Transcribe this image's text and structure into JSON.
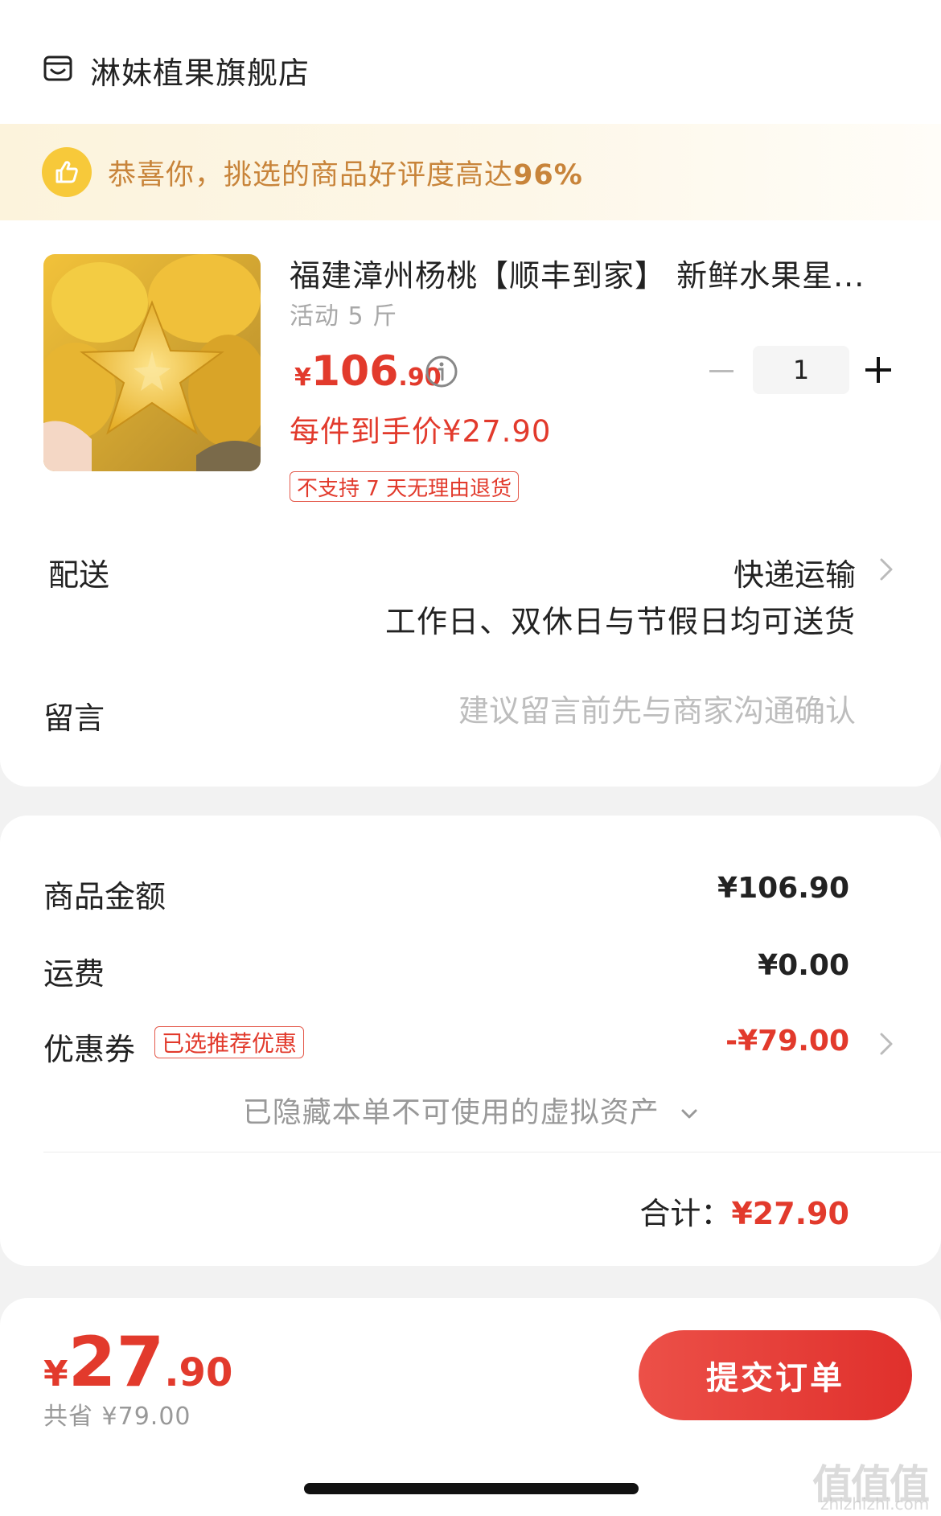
{
  "shop": {
    "name": "淋妹植果旗舰店",
    "icon": "store-icon"
  },
  "rating_banner": {
    "text": "恭喜你，挑选的商品好评度高达",
    "percent": "96%",
    "icon": "thumbs-up-icon"
  },
  "product": {
    "title": "福建漳州杨桃【顺丰到家】 新鲜水果星...",
    "spec": "活动 5 斤",
    "price_symbol": "¥",
    "price_integer": "106",
    "price_decimal": ".90",
    "unit_price": "每件到手价¥27.90",
    "return_policy_tag": "不支持 7 天无理由退货",
    "quantity": "1",
    "image": "starfruit-photo"
  },
  "delivery": {
    "label": "配送",
    "method": "快递运输",
    "note": "工作日、双休日与节假日均可送货"
  },
  "message": {
    "label": "留言",
    "placeholder": "建议留言前先与商家沟通确认"
  },
  "summary": {
    "goods_amount_label": "商品金额",
    "goods_amount": "¥106.90",
    "shipping_label": "运费",
    "shipping": "¥0.00",
    "coupon_label": "优惠券",
    "coupon_tag": "已选推荐优惠",
    "coupon_value": "-¥79.00",
    "hidden_assets": "已隐藏本单不可使用的虚拟资产",
    "total_label": "合计：",
    "total_value": "¥27.90"
  },
  "footer": {
    "price_symbol": "¥",
    "price_integer": "27",
    "price_decimal": ".90",
    "saved": "共省 ¥79.00",
    "submit_label": "提交订单"
  },
  "watermark": {
    "text": "值值值",
    "sub": "zhizhizhi.com"
  },
  "colors": {
    "accent_red": "#e23a2c",
    "banner_gold": "#c8843a",
    "banner_bg": "#fcf3dc"
  }
}
